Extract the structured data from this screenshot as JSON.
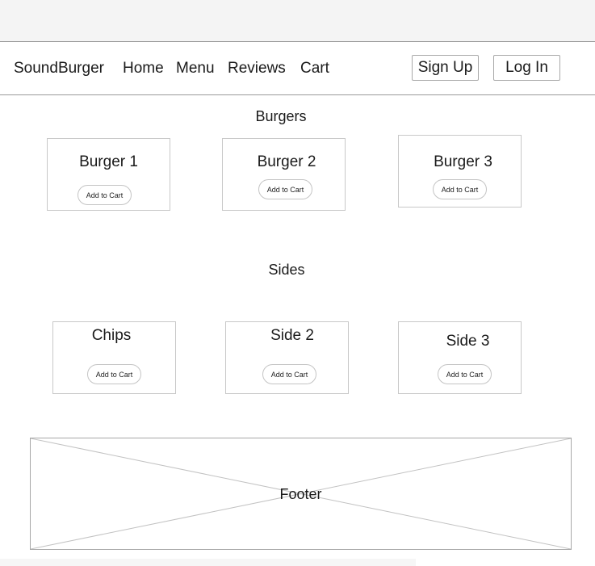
{
  "nav": {
    "brand": "SoundBurger",
    "links": [
      "Home",
      "Menu",
      "Reviews",
      "Cart"
    ],
    "sign_up": "Sign Up",
    "log_in": "Log In"
  },
  "burgers": {
    "title": "Burgers",
    "items": [
      {
        "name": "Burger 1",
        "button": "Add to Cart"
      },
      {
        "name": "Burger 2",
        "button": "Add to Cart"
      },
      {
        "name": "Burger 3",
        "button": "Add to Cart"
      }
    ]
  },
  "sides": {
    "title": "Sides",
    "items": [
      {
        "name": "Chips",
        "button": "Add to Cart"
      },
      {
        "name": "Side 2",
        "button": "Add to Cart"
      },
      {
        "name": "Side 3",
        "button": "Add to Cart"
      }
    ]
  },
  "footer": {
    "label": "Footer"
  }
}
